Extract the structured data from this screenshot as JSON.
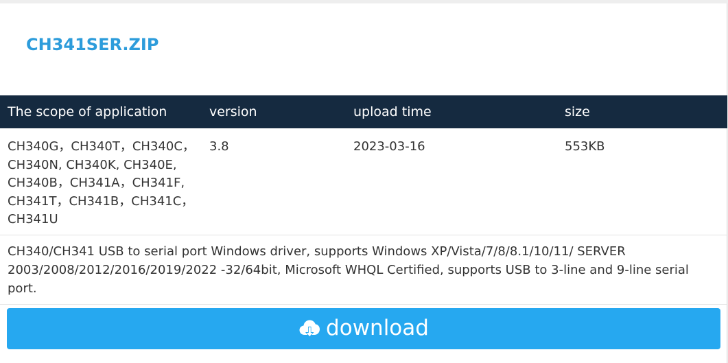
{
  "file": {
    "name": "CH341SER.ZIP"
  },
  "table": {
    "headers": [
      "The scope of application",
      "version",
      "upload time",
      "size"
    ],
    "row": {
      "scope_lines": [
        "CH340G，CH340T，CH340C，",
        "CH340N, CH340K, CH340E,",
        "CH340B，CH341A，CH341F,",
        "CH341T，CH341B，CH341C，",
        "CH341U"
      ],
      "version": "3.8",
      "upload_time": "2023-03-16",
      "size": "553KB"
    }
  },
  "description": "CH340/CH341 USB to serial port Windows driver, supports Windows XP/Vista/7/8/8.1/10/11/ SERVER 2003/2008/2012/2016/2019/2022 -32/64bit, Microsoft WHQL Certified, supports USB to 3-line and 9-line serial port.",
  "download": {
    "label": "download",
    "icon": "cloud-download-icon"
  },
  "colors": {
    "title": "#2d9cdb",
    "header_bg": "#152a40",
    "button_bg": "#26a8f0"
  }
}
